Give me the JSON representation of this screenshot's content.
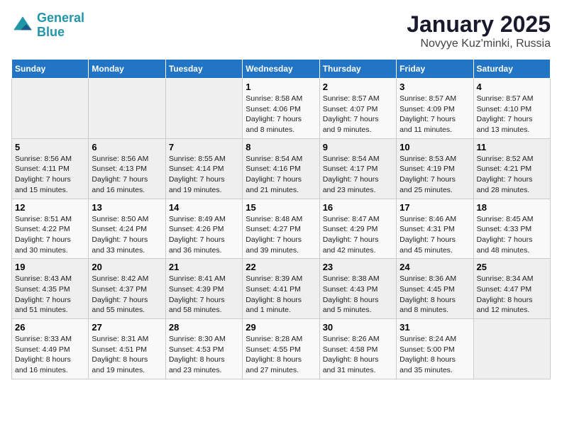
{
  "header": {
    "logo_line1": "General",
    "logo_line2": "Blue",
    "month": "January 2025",
    "location": "Novyye Kuz'minki, Russia"
  },
  "weekdays": [
    "Sunday",
    "Monday",
    "Tuesday",
    "Wednesday",
    "Thursday",
    "Friday",
    "Saturday"
  ],
  "weeks": [
    [
      {
        "day": "",
        "info": ""
      },
      {
        "day": "",
        "info": ""
      },
      {
        "day": "",
        "info": ""
      },
      {
        "day": "1",
        "info": "Sunrise: 8:58 AM\nSunset: 4:06 PM\nDaylight: 7 hours\nand 8 minutes."
      },
      {
        "day": "2",
        "info": "Sunrise: 8:57 AM\nSunset: 4:07 PM\nDaylight: 7 hours\nand 9 minutes."
      },
      {
        "day": "3",
        "info": "Sunrise: 8:57 AM\nSunset: 4:09 PM\nDaylight: 7 hours\nand 11 minutes."
      },
      {
        "day": "4",
        "info": "Sunrise: 8:57 AM\nSunset: 4:10 PM\nDaylight: 7 hours\nand 13 minutes."
      }
    ],
    [
      {
        "day": "5",
        "info": "Sunrise: 8:56 AM\nSunset: 4:11 PM\nDaylight: 7 hours\nand 15 minutes."
      },
      {
        "day": "6",
        "info": "Sunrise: 8:56 AM\nSunset: 4:13 PM\nDaylight: 7 hours\nand 16 minutes."
      },
      {
        "day": "7",
        "info": "Sunrise: 8:55 AM\nSunset: 4:14 PM\nDaylight: 7 hours\nand 19 minutes."
      },
      {
        "day": "8",
        "info": "Sunrise: 8:54 AM\nSunset: 4:16 PM\nDaylight: 7 hours\nand 21 minutes."
      },
      {
        "day": "9",
        "info": "Sunrise: 8:54 AM\nSunset: 4:17 PM\nDaylight: 7 hours\nand 23 minutes."
      },
      {
        "day": "10",
        "info": "Sunrise: 8:53 AM\nSunset: 4:19 PM\nDaylight: 7 hours\nand 25 minutes."
      },
      {
        "day": "11",
        "info": "Sunrise: 8:52 AM\nSunset: 4:21 PM\nDaylight: 7 hours\nand 28 minutes."
      }
    ],
    [
      {
        "day": "12",
        "info": "Sunrise: 8:51 AM\nSunset: 4:22 PM\nDaylight: 7 hours\nand 30 minutes."
      },
      {
        "day": "13",
        "info": "Sunrise: 8:50 AM\nSunset: 4:24 PM\nDaylight: 7 hours\nand 33 minutes."
      },
      {
        "day": "14",
        "info": "Sunrise: 8:49 AM\nSunset: 4:26 PM\nDaylight: 7 hours\nand 36 minutes."
      },
      {
        "day": "15",
        "info": "Sunrise: 8:48 AM\nSunset: 4:27 PM\nDaylight: 7 hours\nand 39 minutes."
      },
      {
        "day": "16",
        "info": "Sunrise: 8:47 AM\nSunset: 4:29 PM\nDaylight: 7 hours\nand 42 minutes."
      },
      {
        "day": "17",
        "info": "Sunrise: 8:46 AM\nSunset: 4:31 PM\nDaylight: 7 hours\nand 45 minutes."
      },
      {
        "day": "18",
        "info": "Sunrise: 8:45 AM\nSunset: 4:33 PM\nDaylight: 7 hours\nand 48 minutes."
      }
    ],
    [
      {
        "day": "19",
        "info": "Sunrise: 8:43 AM\nSunset: 4:35 PM\nDaylight: 7 hours\nand 51 minutes."
      },
      {
        "day": "20",
        "info": "Sunrise: 8:42 AM\nSunset: 4:37 PM\nDaylight: 7 hours\nand 55 minutes."
      },
      {
        "day": "21",
        "info": "Sunrise: 8:41 AM\nSunset: 4:39 PM\nDaylight: 7 hours\nand 58 minutes."
      },
      {
        "day": "22",
        "info": "Sunrise: 8:39 AM\nSunset: 4:41 PM\nDaylight: 8 hours\nand 1 minute."
      },
      {
        "day": "23",
        "info": "Sunrise: 8:38 AM\nSunset: 4:43 PM\nDaylight: 8 hours\nand 5 minutes."
      },
      {
        "day": "24",
        "info": "Sunrise: 8:36 AM\nSunset: 4:45 PM\nDaylight: 8 hours\nand 8 minutes."
      },
      {
        "day": "25",
        "info": "Sunrise: 8:34 AM\nSunset: 4:47 PM\nDaylight: 8 hours\nand 12 minutes."
      }
    ],
    [
      {
        "day": "26",
        "info": "Sunrise: 8:33 AM\nSunset: 4:49 PM\nDaylight: 8 hours\nand 16 minutes."
      },
      {
        "day": "27",
        "info": "Sunrise: 8:31 AM\nSunset: 4:51 PM\nDaylight: 8 hours\nand 19 minutes."
      },
      {
        "day": "28",
        "info": "Sunrise: 8:30 AM\nSunset: 4:53 PM\nDaylight: 8 hours\nand 23 minutes."
      },
      {
        "day": "29",
        "info": "Sunrise: 8:28 AM\nSunset: 4:55 PM\nDaylight: 8 hours\nand 27 minutes."
      },
      {
        "day": "30",
        "info": "Sunrise: 8:26 AM\nSunset: 4:58 PM\nDaylight: 8 hours\nand 31 minutes."
      },
      {
        "day": "31",
        "info": "Sunrise: 8:24 AM\nSunset: 5:00 PM\nDaylight: 8 hours\nand 35 minutes."
      },
      {
        "day": "",
        "info": ""
      }
    ]
  ]
}
